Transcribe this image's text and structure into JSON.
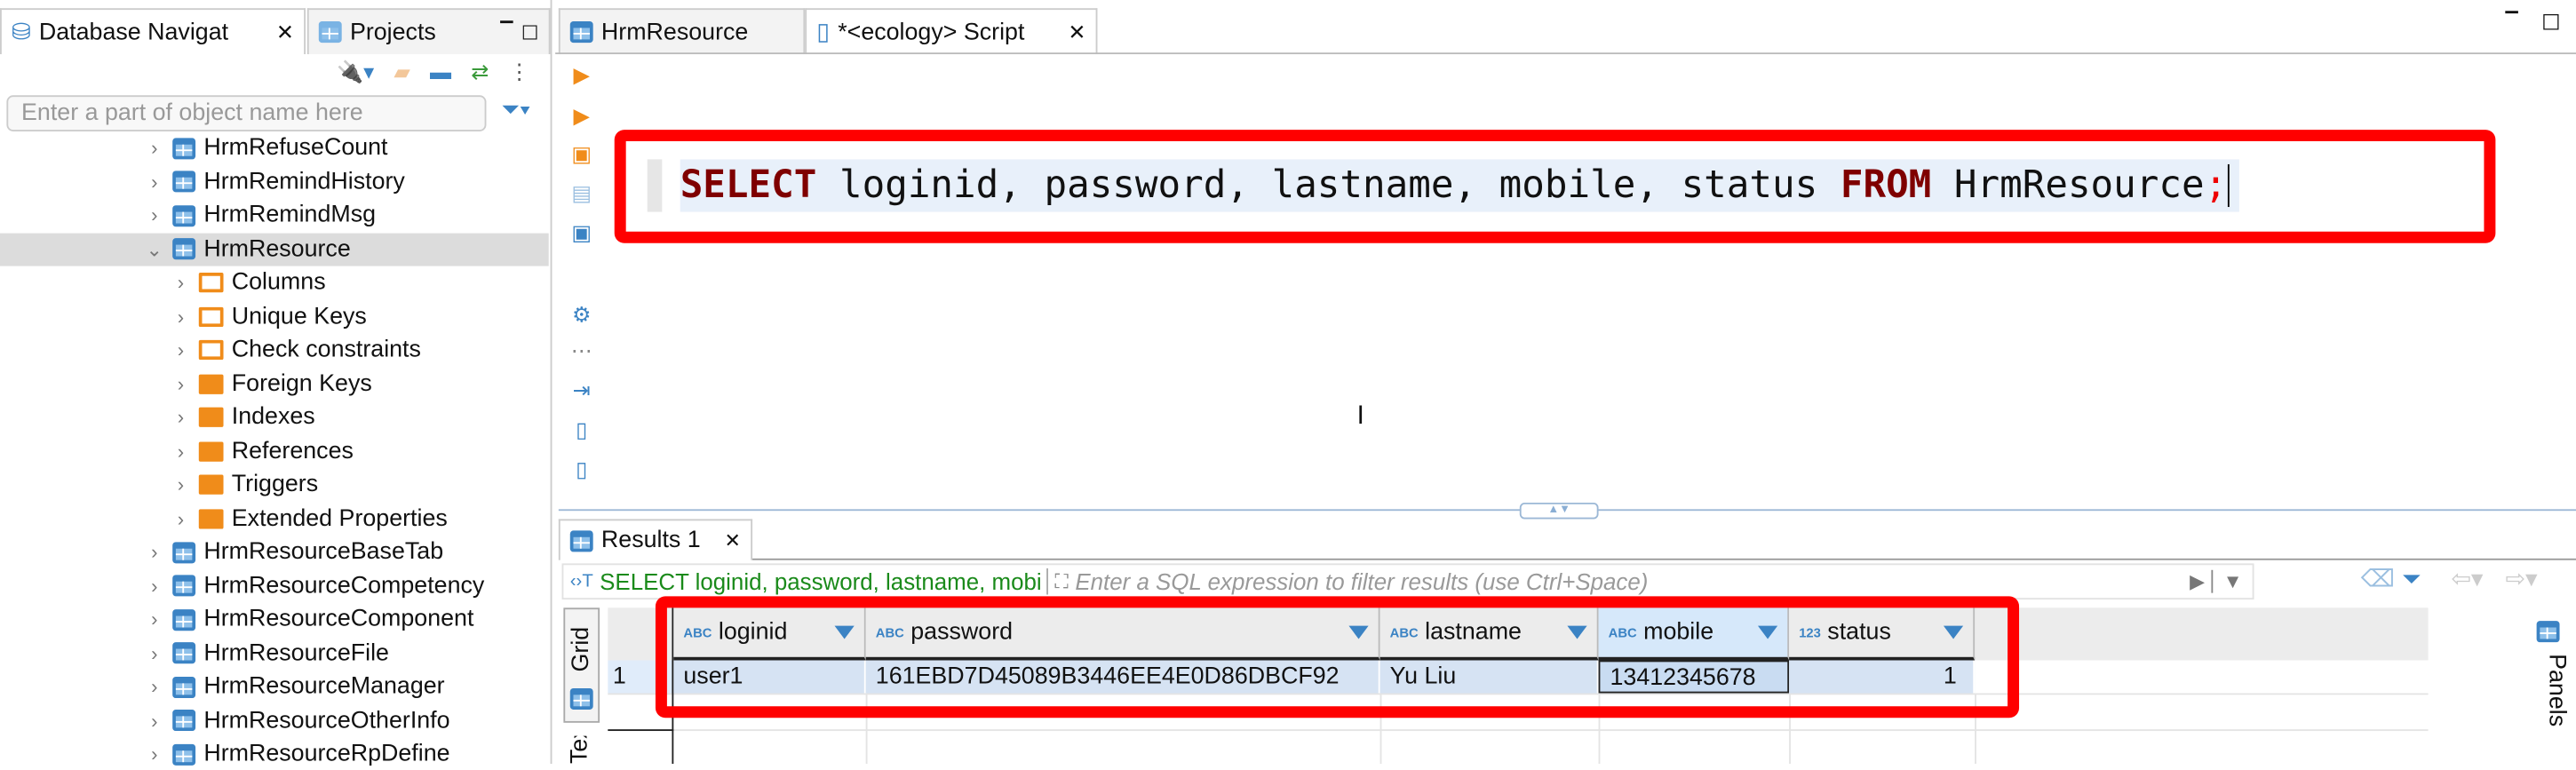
{
  "navigator": {
    "tab_label": "Database Navigat",
    "projects_label": "Projects",
    "filter_placeholder": "Enter a part of object name here",
    "tree": [
      {
        "label": "HrmRefuseCount",
        "level": 0,
        "icon": "table-icon",
        "expanded": false
      },
      {
        "label": "HrmRemindHistory",
        "level": 0,
        "icon": "table-icon",
        "expanded": false
      },
      {
        "label": "HrmRemindMsg",
        "level": 0,
        "icon": "table-icon",
        "expanded": false
      },
      {
        "label": "HrmResource",
        "level": 0,
        "icon": "table-icon",
        "expanded": true,
        "selected": true
      },
      {
        "label": "Columns",
        "level": 1,
        "icon": "columns-icon"
      },
      {
        "label": "Unique Keys",
        "level": 1,
        "icon": "key-icon"
      },
      {
        "label": "Check constraints",
        "level": 1,
        "icon": "constraint-icon"
      },
      {
        "label": "Foreign Keys",
        "level": 1,
        "icon": "folder-icon"
      },
      {
        "label": "Indexes",
        "level": 1,
        "icon": "folder-icon"
      },
      {
        "label": "References",
        "level": 1,
        "icon": "folder-icon"
      },
      {
        "label": "Triggers",
        "level": 1,
        "icon": "folder-icon"
      },
      {
        "label": "Extended Properties",
        "level": 1,
        "icon": "folder-icon"
      },
      {
        "label": "HrmResourceBaseTab",
        "level": 0,
        "icon": "table-icon"
      },
      {
        "label": "HrmResourceCompetency",
        "level": 0,
        "icon": "table-icon"
      },
      {
        "label": "HrmResourceComponent",
        "level": 0,
        "icon": "table-icon"
      },
      {
        "label": "HrmResourceFile",
        "level": 0,
        "icon": "table-icon"
      },
      {
        "label": "HrmResourceManager",
        "level": 0,
        "icon": "table-icon"
      },
      {
        "label": "HrmResourceOtherInfo",
        "level": 0,
        "icon": "table-icon"
      },
      {
        "label": "HrmResourceRpDefine",
        "level": 0,
        "icon": "table-icon"
      }
    ]
  },
  "editor": {
    "tabs": [
      {
        "label": "HrmResource"
      },
      {
        "label": "*<ecology> Script"
      }
    ],
    "sql": {
      "kw1": "SELECT",
      "cols": " loginid, password, lastname, mobile, status ",
      "kw2": "FROM",
      "table": " HrmResource",
      "semi": ";"
    }
  },
  "results": {
    "tab_label": "Results 1",
    "query_preview": "SELECT loginid, password, lastname, mobi",
    "filter_placeholder": "Enter a SQL expression to filter results (use Ctrl+Space)",
    "grid_tab": "Grid",
    "text_tab": "Text",
    "panels_label": "Panels",
    "columns": [
      {
        "name": "loginid",
        "type": "ABC"
      },
      {
        "name": "password",
        "type": "ABC"
      },
      {
        "name": "lastname",
        "type": "ABC"
      },
      {
        "name": "mobile",
        "type": "ABC"
      },
      {
        "name": "status",
        "type": "123"
      }
    ],
    "rows": [
      {
        "num": "1",
        "cells": [
          "user1",
          "161EBD7D45089B3446EE4E0D86DBCF92",
          "Yu Liu",
          "13412345678",
          "1"
        ]
      }
    ]
  },
  "colors": {
    "highlight": "#ff0000",
    "keyword": "#7f0000",
    "accent": "#3b83c4",
    "query_text": "#1a8a1a"
  }
}
